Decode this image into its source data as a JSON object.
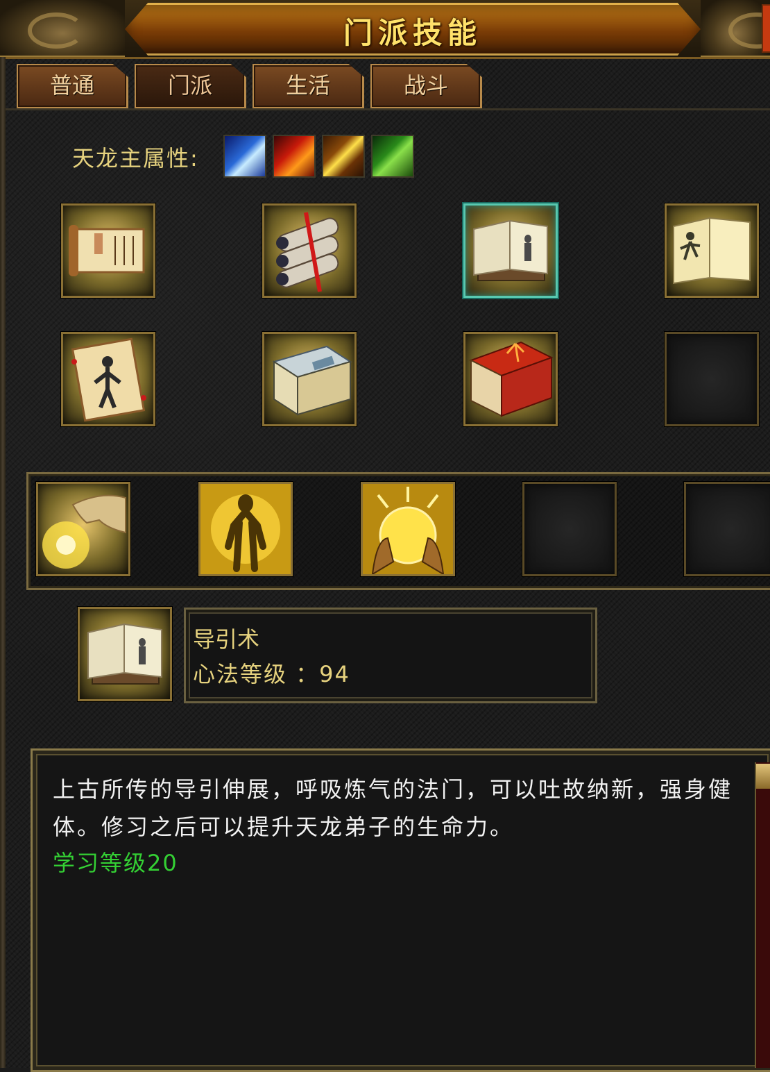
{
  "window": {
    "title": "门派技能"
  },
  "tabs": [
    {
      "label": "普通"
    },
    {
      "label": "门派"
    },
    {
      "label": "生活"
    },
    {
      "label": "战斗"
    }
  ],
  "attributes": {
    "label": "天龙主属性:",
    "icons": [
      "ice-attribute-icon",
      "fire-attribute-icon",
      "lightning-attribute-icon",
      "poison-attribute-icon"
    ]
  },
  "skills": {
    "row1": [
      "scroll-pointing-icon",
      "bundled-scrolls-icon",
      "open-manual-icon",
      "martial-book-icon"
    ],
    "row2": [
      "figure-scroll-icon",
      "stacked-books-icon",
      "red-meridian-book-icon",
      "empty-slot"
    ]
  },
  "heart_methods": [
    "golden-palm-icon",
    "golden-aura-figure-icon",
    "golden-orb-hands-icon",
    "empty-slot",
    "empty-slot"
  ],
  "selected": {
    "icon": "open-manual-icon",
    "name": "导引术",
    "level_text": "心法等级 ：94"
  },
  "description": {
    "text": "上古所传的导引伸展，呼吸炼气的法门，可以吐故纳新，强身健体。修习之后可以提升天龙弟子的生命力。",
    "requirement": "学习等级20"
  }
}
